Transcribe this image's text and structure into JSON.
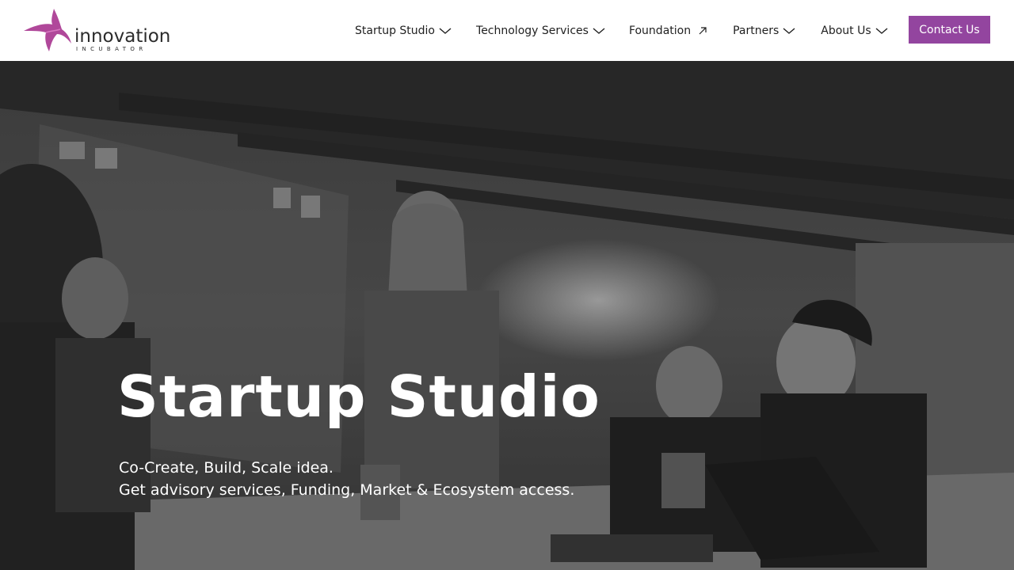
{
  "brand": {
    "name": "innovation",
    "tagline": "INCUBATOR",
    "accent_color": "#93459f",
    "icon": "hummingbird-logo-icon"
  },
  "nav": {
    "items": [
      {
        "label": "Startup Studio",
        "icon": "chevron-down-icon"
      },
      {
        "label": "Technology Services",
        "icon": "chevron-down-icon"
      },
      {
        "label": "Foundation",
        "icon": "external-arrow-icon"
      },
      {
        "label": "Partners",
        "icon": "chevron-down-icon"
      },
      {
        "label": "About Us",
        "icon": "chevron-down-icon"
      }
    ],
    "cta_label": "Contact Us"
  },
  "hero": {
    "title": "Startup Studio",
    "subtitle_line1": "Co-Create, Build, Scale idea.",
    "subtitle_line2": "Get advisory services, Funding, Market & Ecosystem access.",
    "background": "grayscale team meeting photo"
  }
}
